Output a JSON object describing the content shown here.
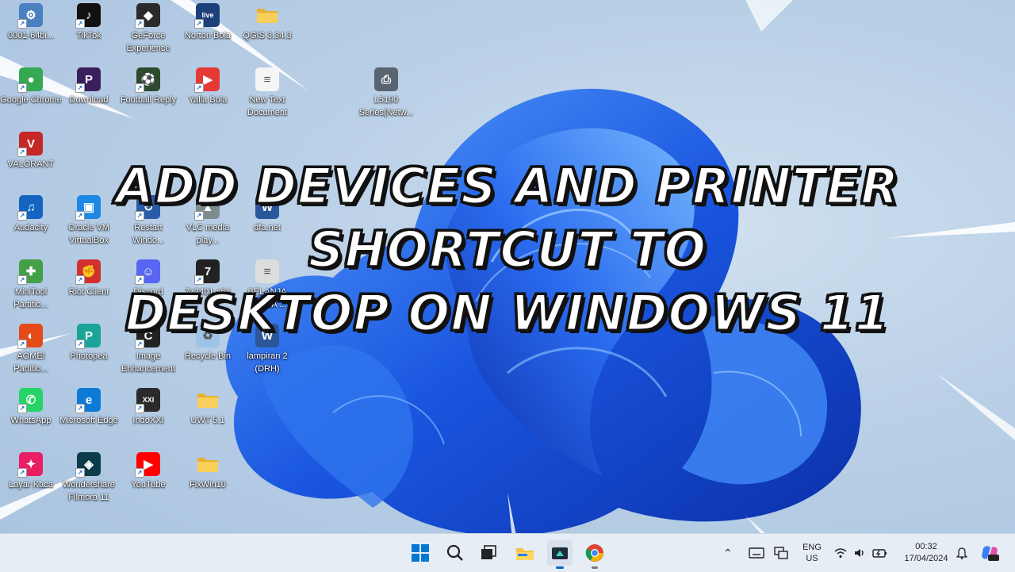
{
  "headline": {
    "line1": "ADD DEVICES AND PRINTER SHORTCUT TO",
    "line2": "DESKTOP ON WINDOWS 11"
  },
  "desktop_icons": [
    {
      "label": "0001-64bi...",
      "icon": "app-icon",
      "color": "#4a7fc0"
    },
    {
      "label": "TikTok",
      "icon": "tiktok-icon",
      "color": "#111111"
    },
    {
      "label": "GeForce Experience",
      "icon": "geforce-icon",
      "color": "#2b2b2b"
    },
    {
      "label": "Norton Bola",
      "icon": "live-icon",
      "color": "#1d3f7a"
    },
    {
      "label": "QGIS 3.34.3",
      "icon": "folder-icon",
      "color": "#f3c545"
    },
    {
      "label": "Google Chrome",
      "icon": "chrome-icon",
      "color": "#34a853"
    },
    {
      "label": "Download",
      "icon": "download-icon",
      "color": "#3b1f5c"
    },
    {
      "label": "Football Reply",
      "icon": "football-icon",
      "color": "#2d4a2d"
    },
    {
      "label": "Yalla Bola",
      "icon": "play-icon",
      "color": "#e53935"
    },
    {
      "label": "New Text Document",
      "icon": "text-doc-icon",
      "color": "#f5f5f5"
    },
    {
      "label": "L5190 Series(Netw...",
      "icon": "printer-icon",
      "color": "#5a6470"
    },
    {
      "label": "VALORANT",
      "icon": "valorant-icon",
      "color": "#c62828"
    },
    {
      "label": "Audacity",
      "icon": "audacity-icon",
      "color": "#1565c0"
    },
    {
      "label": "Oracle VM VirtualBox",
      "icon": "virtualbox-icon",
      "color": "#1e88e5"
    },
    {
      "label": "Restart Windo...",
      "icon": "restart-icon",
      "color": "#2a5ba8"
    },
    {
      "label": "VLC media play...",
      "icon": "vlc-icon",
      "color": "#7f8c8d"
    },
    {
      "label": "dfa.net",
      "icon": "word-icon",
      "color": "#2b579a"
    },
    {
      "label": "MiniTool Partitio...",
      "icon": "minitool-icon",
      "color": "#43a047"
    },
    {
      "label": "Riot Client",
      "icon": "riot-icon",
      "color": "#d32f2f"
    },
    {
      "label": "Discord",
      "icon": "discord-icon",
      "color": "#5865f2"
    },
    {
      "label": "7z2401-x64",
      "icon": "7zip-icon",
      "color": "#222222"
    },
    {
      "label": "BELANJA SERBA ...",
      "icon": "document-icon",
      "color": "#dddddd"
    },
    {
      "label": "AOMEI Partitio...",
      "icon": "aomei-icon",
      "color": "#e64a19"
    },
    {
      "label": "Photopea",
      "icon": "photopea-icon",
      "color": "#18a497"
    },
    {
      "label": "Image Enhancement",
      "icon": "image-enhance-icon",
      "color": "#222222"
    },
    {
      "label": "Recycle Bin",
      "icon": "recycle-bin-icon",
      "color": "#9ec3e8"
    },
    {
      "label": "lampiran 2 (DRH)",
      "icon": "word-icon",
      "color": "#2b579a"
    },
    {
      "label": "WhatsApp",
      "icon": "whatsapp-icon",
      "color": "#25d366"
    },
    {
      "label": "Microsoft Edge",
      "icon": "edge-icon",
      "color": "#0c7bd8"
    },
    {
      "label": "IndoXXI",
      "icon": "indoxxi-icon",
      "color": "#2a2a2a"
    },
    {
      "label": "UWT 5.1",
      "icon": "folder-icon",
      "color": "#f3c545"
    },
    {
      "label": "Layar Kaca",
      "icon": "layarkaca-icon",
      "color": "#e91e63"
    },
    {
      "label": "Wondershare Filmora 11",
      "icon": "filmora-icon",
      "color": "#0c3b4a"
    },
    {
      "label": "YouTube",
      "icon": "youtube-icon",
      "color": "#ff0000"
    },
    {
      "label": "FixWin10",
      "icon": "folder-icon",
      "color": "#f3c545"
    }
  ],
  "taskbar": {
    "input_lang": "ENG",
    "input_region": "US",
    "time": "00:32",
    "date": "17/04/2024"
  },
  "colors": {
    "taskbar_bg": "#e7edf5",
    "bloom_blue": "#1a56e0",
    "bloom_dark": "#0b2fa8"
  }
}
